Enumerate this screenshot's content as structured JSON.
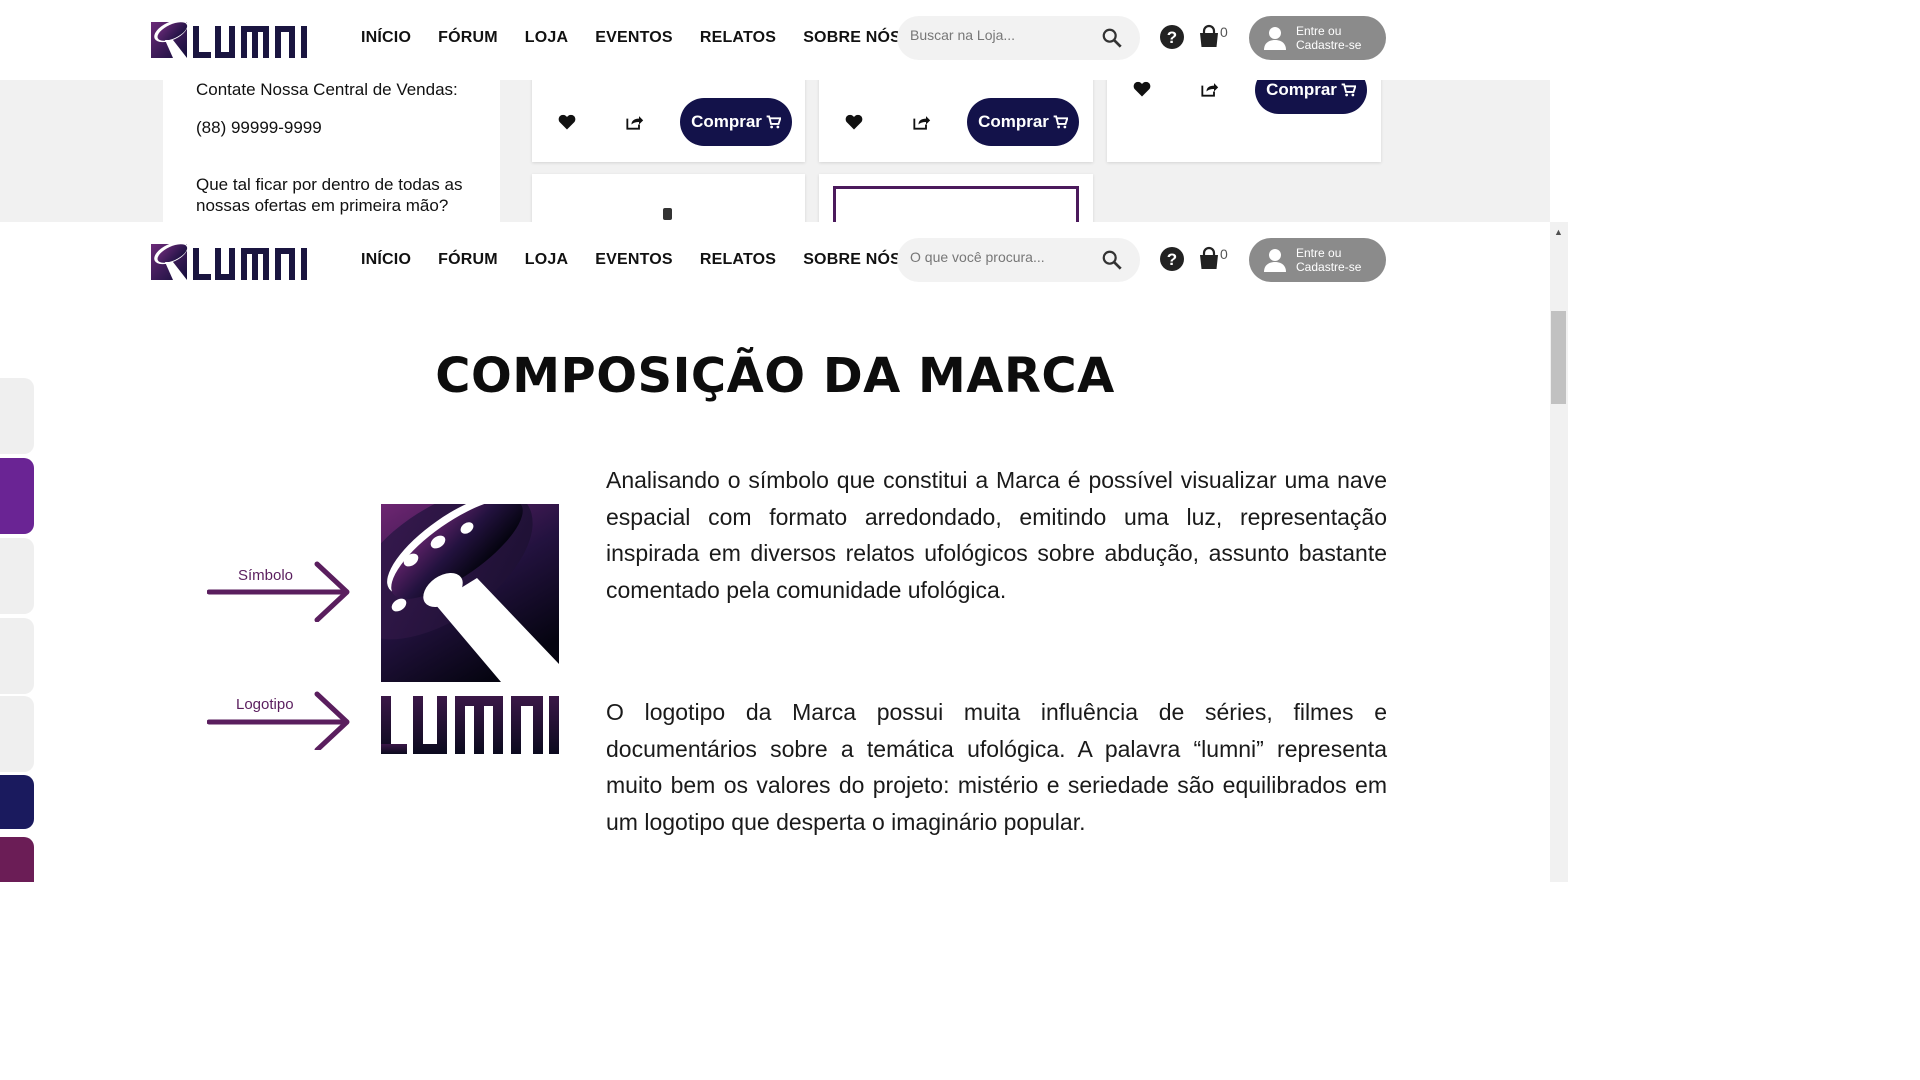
{
  "nav_top": {
    "menu": [
      "INÍCIO",
      "FÓRUM",
      "LOJA",
      "EVENTOS",
      "RELATOS",
      "SOBRE NÓS"
    ],
    "search_placeholder": "Buscar na Loja...",
    "cart_count": "0",
    "login_line1": "Entre ou",
    "login_line2": "Cadastre-se"
  },
  "store": {
    "contact_title": "Contate Nossa Central de Vendas:",
    "phone": "(88) 99999-9999",
    "newsletter_line1": "Que tal ficar por dentro de todas as",
    "newsletter_line2": "nossas ofertas em primeira mão?",
    "buy_label": "Comprar"
  },
  "nav_bottom": {
    "menu": [
      "INÍCIO",
      "FÓRUM",
      "LOJA",
      "EVENTOS",
      "RELATOS",
      "SOBRE NÓS"
    ],
    "search_placeholder": "O que você procura...",
    "cart_count": "0",
    "login_line1": "Entre ou",
    "login_line2": "Cadastre-se"
  },
  "brand": {
    "title": "COMPOSIÇÃO DA MARCA",
    "symbol_label": "Símbolo",
    "logotype_label": "Logotipo",
    "paragraph1": "Analisando o símbolo que constitui a Marca é possível visualizar uma nave espacial com formato arredondado, emitindo uma luz, representação inspirada em diversos relatos ufológicos sobre abdução, assunto bastante comentado pela comunidade ufológica.",
    "paragraph2": "O logotipo da Marca possui muita influência de séries, filmes e documentários sobre a temática ufológica. A palavra “lumni” representa muito bem os valores do projeto: mistério e seriedade são equilibrados em um logotipo que desperta o imaginário popular."
  },
  "colors": {
    "brand_purple": "#5a1e5e",
    "brand_navy": "#13124a",
    "tab_purple": "#6a2494",
    "tab_navy": "#1a1a5e",
    "tab_magenta": "#6b1d56"
  }
}
